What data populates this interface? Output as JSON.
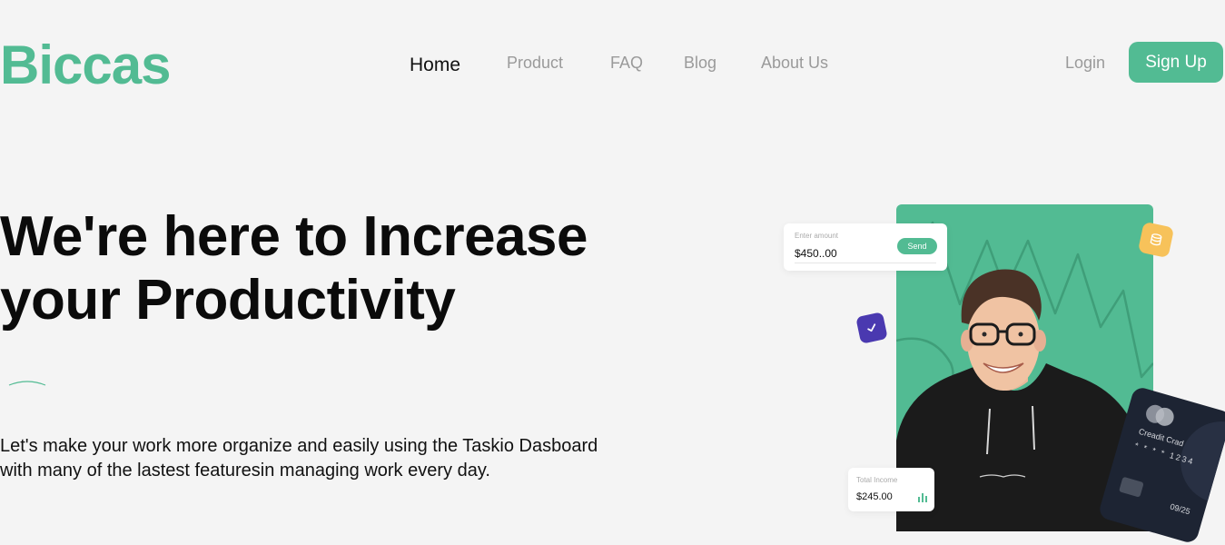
{
  "brand": {
    "name": "Biccas",
    "color": "#52bb93"
  },
  "nav": {
    "items": [
      {
        "label": "Home",
        "active": true
      },
      {
        "label": "Product",
        "active": false
      },
      {
        "label": "FAQ",
        "active": false
      },
      {
        "label": "Blog",
        "active": false
      },
      {
        "label": "About Us",
        "active": false
      }
    ],
    "login_label": "Login",
    "signup_label": "Sign Up"
  },
  "hero": {
    "title_line1": "We're here to Increase",
    "title_line2": "your Productivity",
    "subtitle_line1": "Let's make your work more organize and easily using the Taskio Dasboard",
    "subtitle_line2": "with many of the lastest featuresin managing work every day."
  },
  "widgets": {
    "amount_card": {
      "label": "Enter amount",
      "value": "$450..00",
      "button_label": "Send"
    },
    "credit_card": {
      "name": "Creadit Crad",
      "masked": "* * * *  1234",
      "expiry": "09/25"
    },
    "income_card": {
      "label": "Total Income",
      "value": "$245.00"
    },
    "icons": [
      "check-icon",
      "coin-stack-icon",
      "bar-chart-icon"
    ]
  },
  "colors": {
    "accent": "#52bb93",
    "background": "#f4f4f4",
    "purple_badge": "#4a39b0",
    "yellow_badge": "#f7c25a",
    "card_dark": "#1d2433"
  }
}
